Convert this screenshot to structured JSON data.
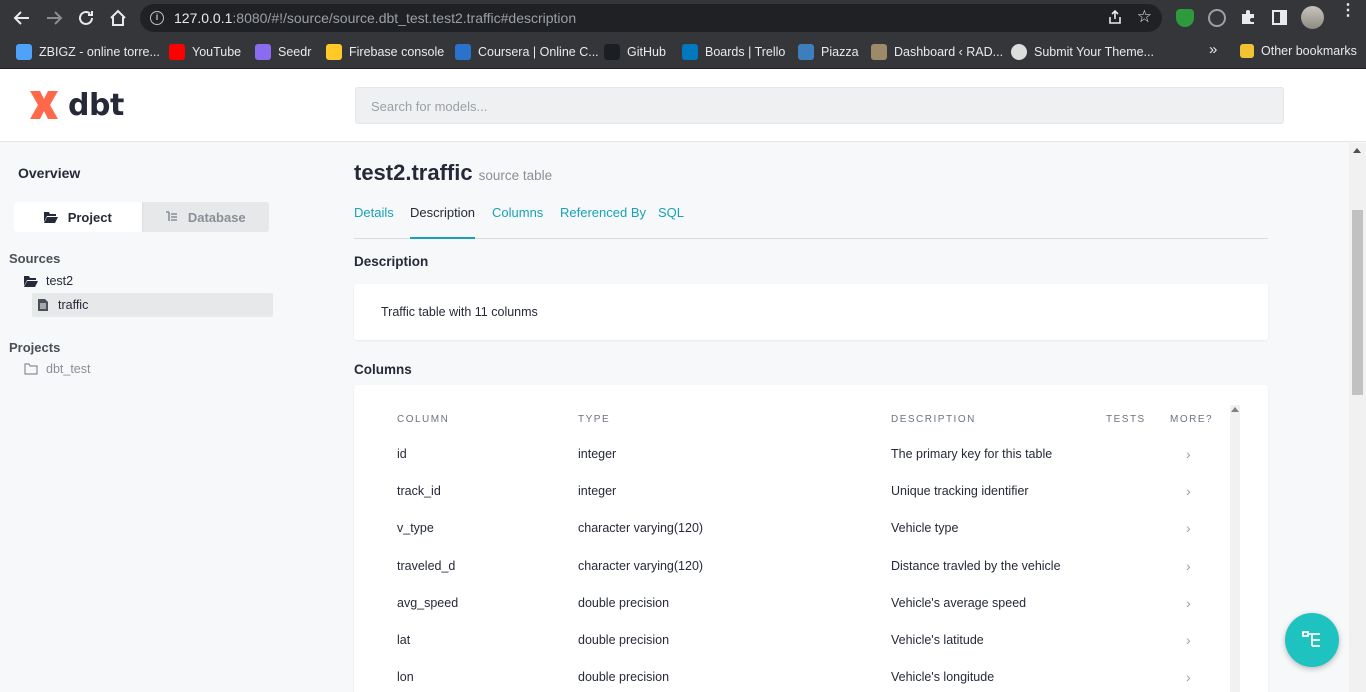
{
  "browser": {
    "url_host": "127.0.0.1",
    "url_rest": ":8080/#!/source/source.dbt_test.test2.traffic#description",
    "bookmarks": [
      {
        "label": "ZBIGZ - online torre...",
        "color": "#4fa3f7"
      },
      {
        "label": "YouTube",
        "color": "#ff0000"
      },
      {
        "label": "Seedr",
        "color": "#8a6cf0"
      },
      {
        "label": "Firebase console",
        "color": "#ffca28"
      },
      {
        "label": "Coursera | Online C...",
        "color": "#2a73cc"
      },
      {
        "label": "GitHub",
        "color": "#1b1f23"
      },
      {
        "label": "Boards | Trello",
        "color": "#0079bf"
      },
      {
        "label": "Piazza",
        "color": "#3e7ebc"
      },
      {
        "label": "Dashboard ‹ RAD...",
        "color": "#9c8a6b"
      },
      {
        "label": "Submit Your Theme...",
        "color": "#dddddd"
      }
    ],
    "overflow_label": "»",
    "other_bookmarks": "Other bookmarks"
  },
  "header": {
    "logo_text": "dbt",
    "search_placeholder": "Search for models..."
  },
  "sidebar": {
    "overview": "Overview",
    "project_tab": "Project",
    "database_tab": "Database",
    "sources_title": "Sources",
    "source_folder": "test2",
    "source_table": "traffic",
    "projects_title": "Projects",
    "project_folder": "dbt_test"
  },
  "main": {
    "title": "test2.traffic",
    "subtitle": "source table",
    "tabs": [
      "Details",
      "Description",
      "Columns",
      "Referenced By",
      "SQL"
    ],
    "active_tab": "Description",
    "description_heading": "Description",
    "description_text": "Traffic table with 11 colunms",
    "columns_heading": "Columns",
    "table_headers": [
      "COLUMN",
      "TYPE",
      "DESCRIPTION",
      "TESTS",
      "MORE?"
    ],
    "rows": [
      {
        "column": "id",
        "type": "integer",
        "description": "The primary key for this table"
      },
      {
        "column": "track_id",
        "type": "integer",
        "description": "Unique tracking identifier"
      },
      {
        "column": "v_type",
        "type": "character varying(120)",
        "description": "Vehicle type"
      },
      {
        "column": "traveled_d",
        "type": "character varying(120)",
        "description": "Distance travled by the vehicle"
      },
      {
        "column": "avg_speed",
        "type": "double precision",
        "description": "Vehicle's average speed"
      },
      {
        "column": "lat",
        "type": "double precision",
        "description": "Vehicle's latitude"
      },
      {
        "column": "lon",
        "type": "double precision",
        "description": "Vehicle's longitude"
      }
    ]
  },
  "colors": {
    "accent": "#17a2b8",
    "fab": "#1ec2be",
    "logo": "#ff694a"
  }
}
